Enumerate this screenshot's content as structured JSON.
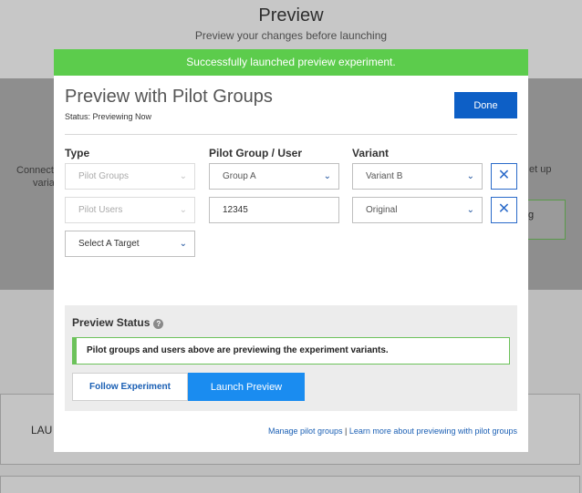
{
  "background": {
    "title": "Preview",
    "subtitle": "Preview your changes before launching",
    "left_text_1": "Connect",
    "left_text_2": "varia",
    "right_text": "et up",
    "right_box_text": "g",
    "lower_label": "LAU"
  },
  "banner": {
    "text": "Successfully launched preview experiment."
  },
  "modal": {
    "title": "Preview with Pilot Groups",
    "status": "Status: Previewing Now",
    "done_label": "Done",
    "headers": {
      "type": "Type",
      "pilot": "Pilot Group / User",
      "variant": "Variant"
    },
    "rows": [
      {
        "type": "Pilot Groups",
        "pilot": "Group A",
        "variant": "Variant B"
      },
      {
        "type": "Pilot Users",
        "pilot": "12345",
        "variant": "Original"
      }
    ],
    "target_placeholder": "Select A Target",
    "preview_status": {
      "title": "Preview Status",
      "message": "Pilot groups and users above are previewing the experiment variants.",
      "follow_label": "Follow Experiment",
      "launch_label": "Launch Preview"
    },
    "links": {
      "manage": "Manage pilot groups",
      "separator": "|",
      "learn": "Learn more about previewing with pilot groups"
    }
  },
  "colors": {
    "banner": "#5ccc4c",
    "primary": "#0d5fc6",
    "launch": "#1a8cf0",
    "success_border": "#6cc25a"
  },
  "icons": {
    "close": "close-icon",
    "chevron": "chevron-down-icon",
    "help": "help-icon"
  }
}
